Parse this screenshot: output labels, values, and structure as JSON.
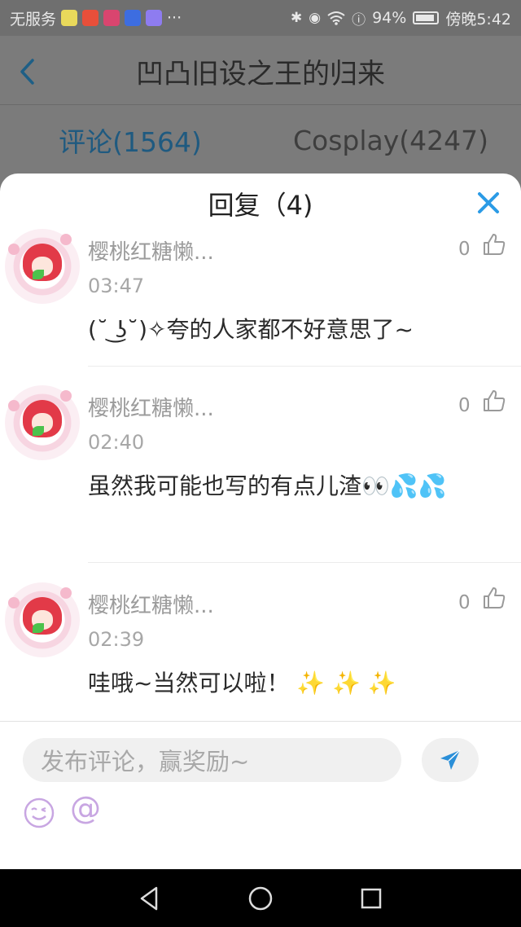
{
  "status_bar": {
    "carrier": "无服务",
    "more": "···",
    "battery": "94%",
    "time": "傍晚5:42"
  },
  "header": {
    "title": "凹凸旧设之王的归来"
  },
  "tabs": [
    {
      "label": "评论(1564)"
    },
    {
      "label": "Cosplay(4247)"
    }
  ],
  "sheet": {
    "title": "回复（4)"
  },
  "replies": [
    {
      "user": "樱桃红糖懒...",
      "time": "03:47",
      "likes": "0",
      "text": "(˘ ͜ʖ˘)✧夸的人家都不好意思了~"
    },
    {
      "user": "樱桃红糖懒...",
      "time": "02:40",
      "likes": "0",
      "text": "虽然我可能也写的有点儿渣👀💦💦"
    },
    {
      "user": "樱桃红糖懒...",
      "time": "02:39",
      "likes": "0",
      "text": "哇哦~当然可以啦！ ✨ ✨ ✨"
    }
  ],
  "input": {
    "placeholder": "发布评论，赢奖励~",
    "at_label": "@"
  },
  "colors": {
    "accent": "#2b8fd8",
    "close": "#2b9be6",
    "send": "#2b8fd8"
  }
}
